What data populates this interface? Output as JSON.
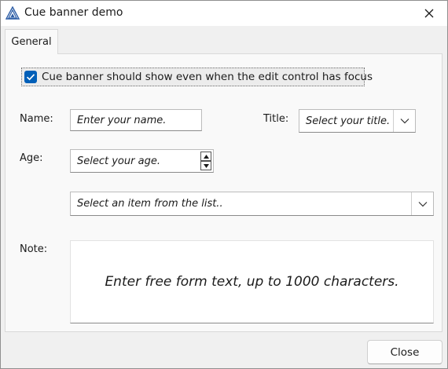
{
  "window": {
    "title": "Cue banner demo"
  },
  "tabs": [
    {
      "label": "General",
      "selected": true
    }
  ],
  "checkbox": {
    "label": "Cue banner should show even when the edit control has focus",
    "checked": true
  },
  "fields": {
    "name": {
      "label": "Name:",
      "placeholder": "Enter your name."
    },
    "title": {
      "label": "Title:",
      "placeholder": "Select your title."
    },
    "age": {
      "label": "Age:",
      "placeholder": "Select your age."
    },
    "list": {
      "placeholder": "Select an item from the list.."
    },
    "note": {
      "label": "Note:",
      "placeholder": "Enter free form text, up to 1000 characters."
    }
  },
  "buttons": {
    "close": "Close"
  },
  "colors": {
    "accent": "#005fb8",
    "icon_blue": "#2f5fa7"
  },
  "icons": [
    "app-icon",
    "close-icon",
    "checkmark-icon",
    "chevron-down-icon",
    "spin-up-icon",
    "spin-down-icon"
  ]
}
